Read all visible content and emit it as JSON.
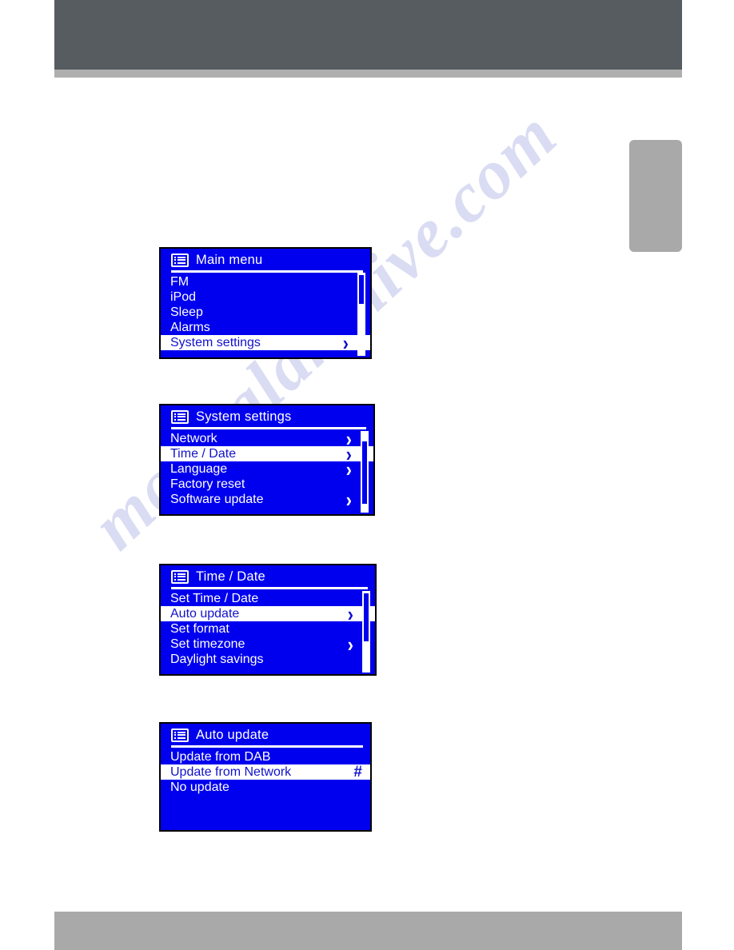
{
  "page": {
    "header_color": "#565c60",
    "header_rule_color": "#afafaf",
    "footer_color": "#a9a9a9",
    "side_tab_color": "#a9a9a9",
    "lcd_background": "#0000ee",
    "lcd_text_color": "#ffffff",
    "highlight_background": "#ffffff",
    "highlight_text_color": "#1111cc",
    "watermark": "manualarchive.com"
  },
  "screens": [
    {
      "id": "main-menu",
      "icon": "menu-list-icon",
      "title": "Main  menu",
      "rows": [
        {
          "label": "FM",
          "marker": "",
          "selected": false
        },
        {
          "label": "iPod",
          "marker": "",
          "selected": false
        },
        {
          "label": "Sleep",
          "marker": "",
          "selected": false
        },
        {
          "label": "Alarms",
          "marker": "",
          "selected": false
        },
        {
          "label": "System  settings",
          "marker": "chevron",
          "selected": true
        }
      ],
      "scrollbar": true
    },
    {
      "id": "system-settings",
      "icon": "menu-list-icon",
      "title": "System  settings",
      "rows": [
        {
          "label": "Network",
          "marker": "chevron",
          "selected": false
        },
        {
          "label": "Time / Date",
          "marker": "chevron",
          "selected": true
        },
        {
          "label": "Language",
          "marker": "chevron",
          "selected": false
        },
        {
          "label": "Factory  reset",
          "marker": "",
          "selected": false
        },
        {
          "label": "Software  update",
          "marker": "chevron",
          "selected": false
        }
      ],
      "scrollbar": true
    },
    {
      "id": "time-date",
      "icon": "menu-list-icon",
      "title": "Time / Date",
      "rows": [
        {
          "label": "Set  Time / Date",
          "marker": "",
          "selected": false
        },
        {
          "label": "Auto  update",
          "marker": "chevron",
          "selected": true
        },
        {
          "label": "Set  format",
          "marker": "",
          "selected": false
        },
        {
          "label": "Set  timezone",
          "marker": "chevron",
          "selected": false
        },
        {
          "label": "Daylight  savings",
          "marker": "",
          "selected": false
        }
      ],
      "scrollbar": true
    },
    {
      "id": "auto-update",
      "icon": "menu-list-icon",
      "title": "Auto  update",
      "rows": [
        {
          "label": "Update  from DAB",
          "marker": "",
          "selected": false
        },
        {
          "label": "Update  from  Network",
          "marker": "#",
          "selected": true
        },
        {
          "label": "No  update",
          "marker": "",
          "selected": false
        }
      ],
      "scrollbar": false
    }
  ]
}
